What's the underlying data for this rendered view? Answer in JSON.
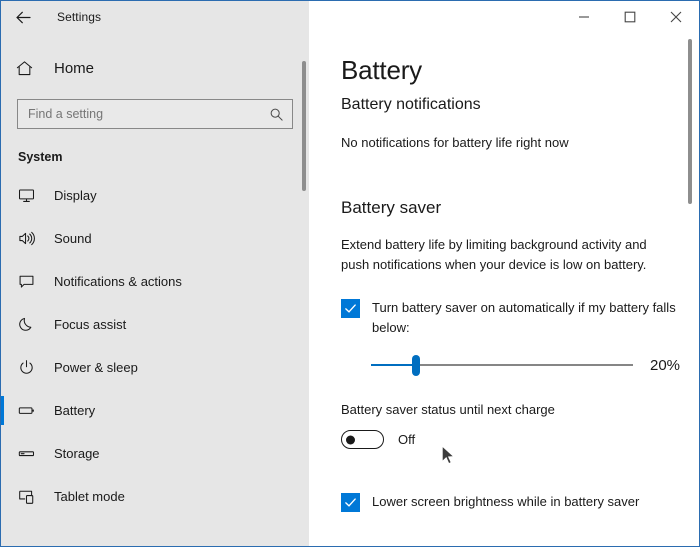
{
  "titlebar": {
    "back_icon": "back-arrow-icon",
    "title": "Settings",
    "minimize_label": "minimize-icon",
    "maximize_label": "maximize-icon",
    "close_label": "close-icon"
  },
  "sidebar": {
    "home": {
      "label": "Home",
      "icon": "home-icon"
    },
    "search": {
      "value": "",
      "placeholder": "Find a setting",
      "icon": "search-icon"
    },
    "section": "System",
    "items": [
      {
        "label": "Display",
        "icon": "monitor-icon",
        "selected": false
      },
      {
        "label": "Sound",
        "icon": "speaker-icon",
        "selected": false
      },
      {
        "label": "Notifications & actions",
        "icon": "notification-icon",
        "selected": false
      },
      {
        "label": "Focus assist",
        "icon": "moon-icon",
        "selected": false
      },
      {
        "label": "Power & sleep",
        "icon": "power-icon",
        "selected": false
      },
      {
        "label": "Battery",
        "icon": "battery-icon",
        "selected": true
      },
      {
        "label": "Storage",
        "icon": "storage-icon",
        "selected": false
      },
      {
        "label": "Tablet mode",
        "icon": "tablet-icon",
        "selected": false
      }
    ]
  },
  "main": {
    "page_title": "Battery",
    "notifications_heading": "Battery notifications",
    "notifications_text": "No notifications for battery life right now",
    "saver_heading": "Battery saver",
    "saver_description": "Extend battery life by limiting background activity and push notifications when your device is low on battery.",
    "auto_checkbox": {
      "label": "Turn battery saver on automatically if my battery falls below:",
      "checked": true
    },
    "slider": {
      "value_label": "20%",
      "value": 20,
      "min": 0,
      "max": 100,
      "fill_percent": 17
    },
    "toggle": {
      "label": "Battery saver status until next charge",
      "state": "Off",
      "on": false
    },
    "brightness_checkbox": {
      "label": "Lower screen brightness while in battery saver",
      "checked": true
    }
  },
  "colors": {
    "accent": "#0078d7",
    "slider_accent": "#006ec0",
    "sidebar_bg": "#e6e6e6",
    "window_border": "#2b6cb0"
  }
}
